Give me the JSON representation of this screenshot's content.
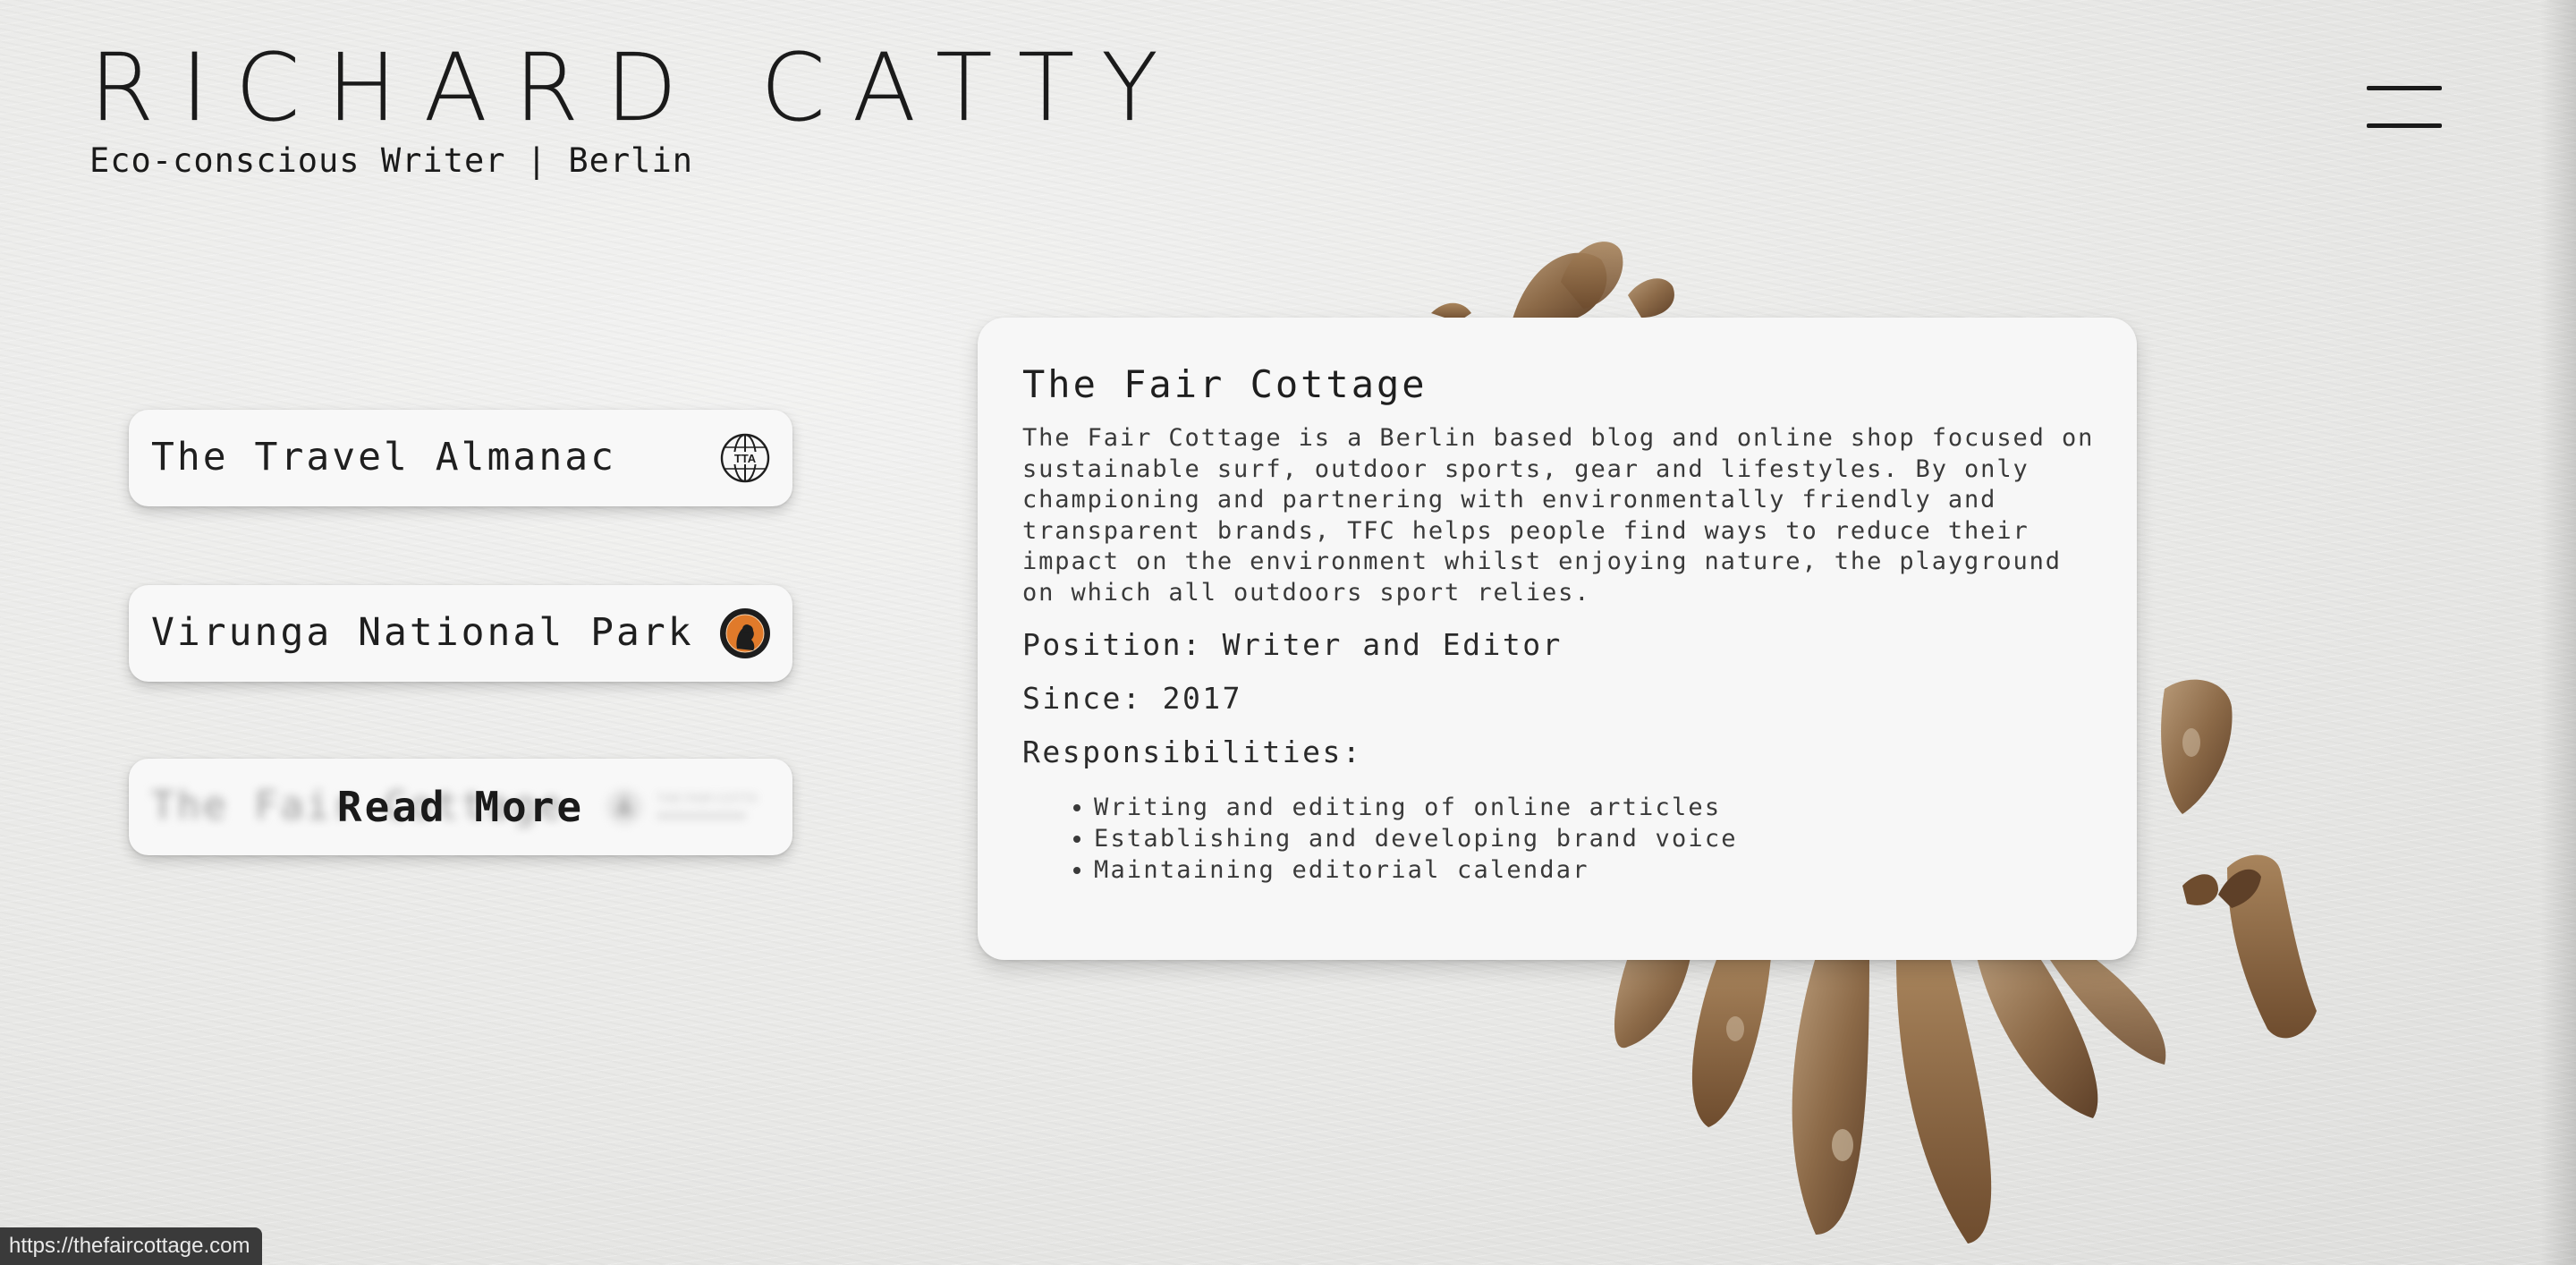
{
  "header": {
    "title": "RICHARD CATTY",
    "subtitle": "Eco-conscious Writer | Berlin",
    "menu_icon": "hamburger-menu-icon"
  },
  "cards": [
    {
      "label": "The Travel Almanac",
      "logo_text": "TTA",
      "logo_icon": "globe-logo-icon"
    },
    {
      "label": "Virunga National Park",
      "logo_icon": "gorilla-badge-icon"
    },
    {
      "label": "The Fair Cottage",
      "logo_text": "THE FAIR COTTAGE",
      "hover_label": "Read More",
      "logo_icon": "cottage-logo-icon"
    }
  ],
  "detail": {
    "title": "The Fair Cottage",
    "description": "The Fair Cottage is a Berlin based blog and online shop focused on sustainable surf, outdoor sports, gear and lifestyles. By only championing and partnering with environmentally friendly and transparent brands, TFC helps people find ways to reduce their impact on the environment whilst enjoying nature, the playground on which all outdoors sport relies.",
    "position": "Position: Writer and Editor",
    "since": "Since: 2017",
    "responsibilities_label": "Responsibilities:",
    "responsibilities": [
      "Writing and editing of online articles",
      "Establishing and developing brand voice",
      "Maintaining editorial calendar"
    ]
  },
  "status_bar": {
    "url": "https://thefaircottage.com"
  },
  "colors": {
    "background": "#ebebe9",
    "card": "#f8f8f8",
    "text": "#1d1d1d",
    "status_bar": "#3a3a3a",
    "badge_orange": "#e07a2a"
  }
}
